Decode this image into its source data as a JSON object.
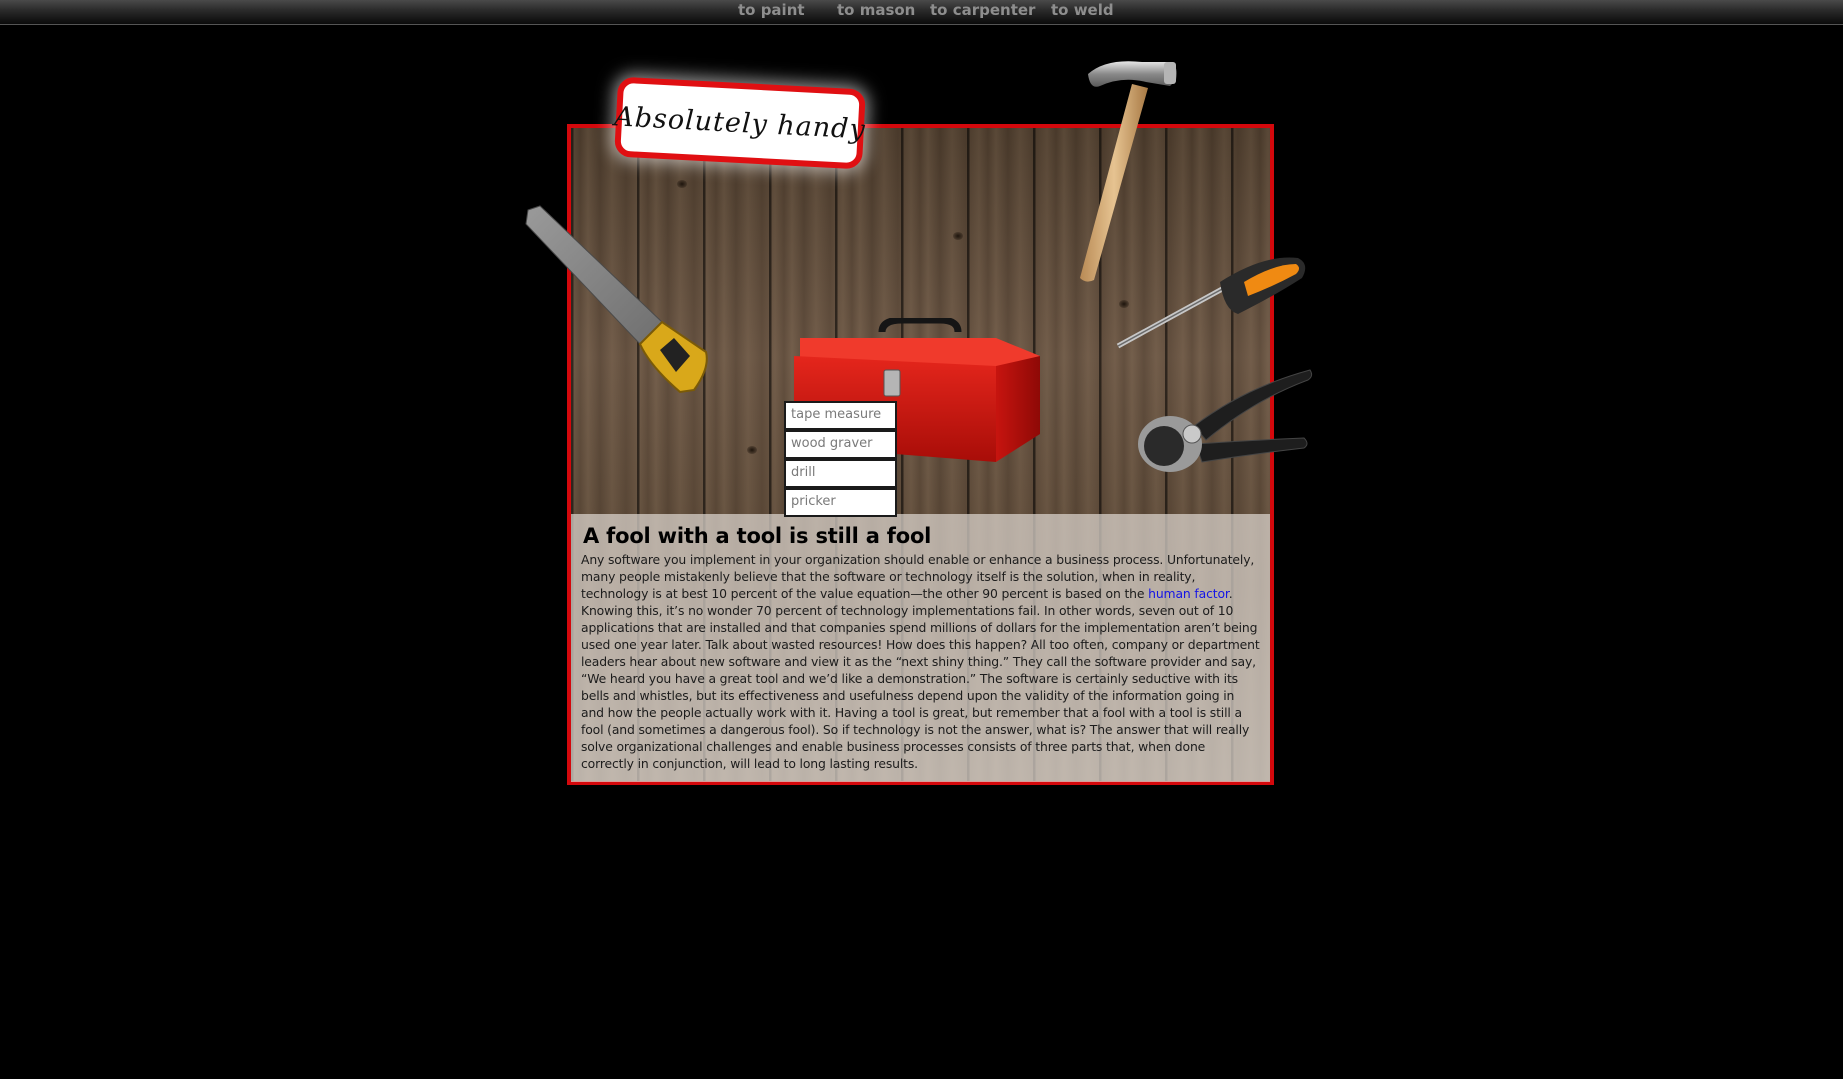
{
  "nav": {
    "items": [
      {
        "label": "to paint"
      },
      {
        "label": "to mason"
      },
      {
        "label": "to carpenter"
      },
      {
        "label": "to weld"
      }
    ]
  },
  "logo": {
    "text": "Absolutely handy"
  },
  "toolbox": {
    "items": [
      {
        "label": "tape measure"
      },
      {
        "label": "wood graver"
      },
      {
        "label": "drill"
      },
      {
        "label": "pricker"
      }
    ]
  },
  "article": {
    "heading": "A fool with a tool is still a fool",
    "body_before_link": "Any software you implement in your organization should enable or enhance a business process. Unfortunately, many people mistakenly believe that the software or technology itself is the solution, when in reality, technology is at best 10 percent of the value equation—the other 90 percent is based on the ",
    "link_text": "human factor",
    "body_after_link": ". Knowing this, it’s no wonder 70 percent of technology implementations fail. In other words, seven out of 10 applications that are installed and that companies spend millions of dollars for the implementation aren’t being used one year later. Talk about wasted resources! How does this happen? All too often, company or department leaders hear about new software and view it as the “next shiny thing.” They call the software provider and say, “We heard you have a great tool and we’d like a demonstration.” The software is certainly seductive with its bells and whistles, but its effectiveness and usefulness depend upon the validity of the information going in and how the people actually work with it. Having a tool is great, but remember that a fool with a tool is still a fool (and sometimes a dangerous fool). So if technology is not the answer, what is? The answer that will really solve organizational challenges and enable business processes consists of three parts that, when done correctly in conjunction, will lead to long lasting results."
  },
  "colors": {
    "background": "#000000",
    "accent_red": "#d4080c",
    "nav_text": "#8e8e8e",
    "link": "#1515e6"
  },
  "icons": [
    "hammer-icon",
    "saw-icon",
    "screwdriver-icon",
    "pliers-icon",
    "toolbox-icon"
  ]
}
